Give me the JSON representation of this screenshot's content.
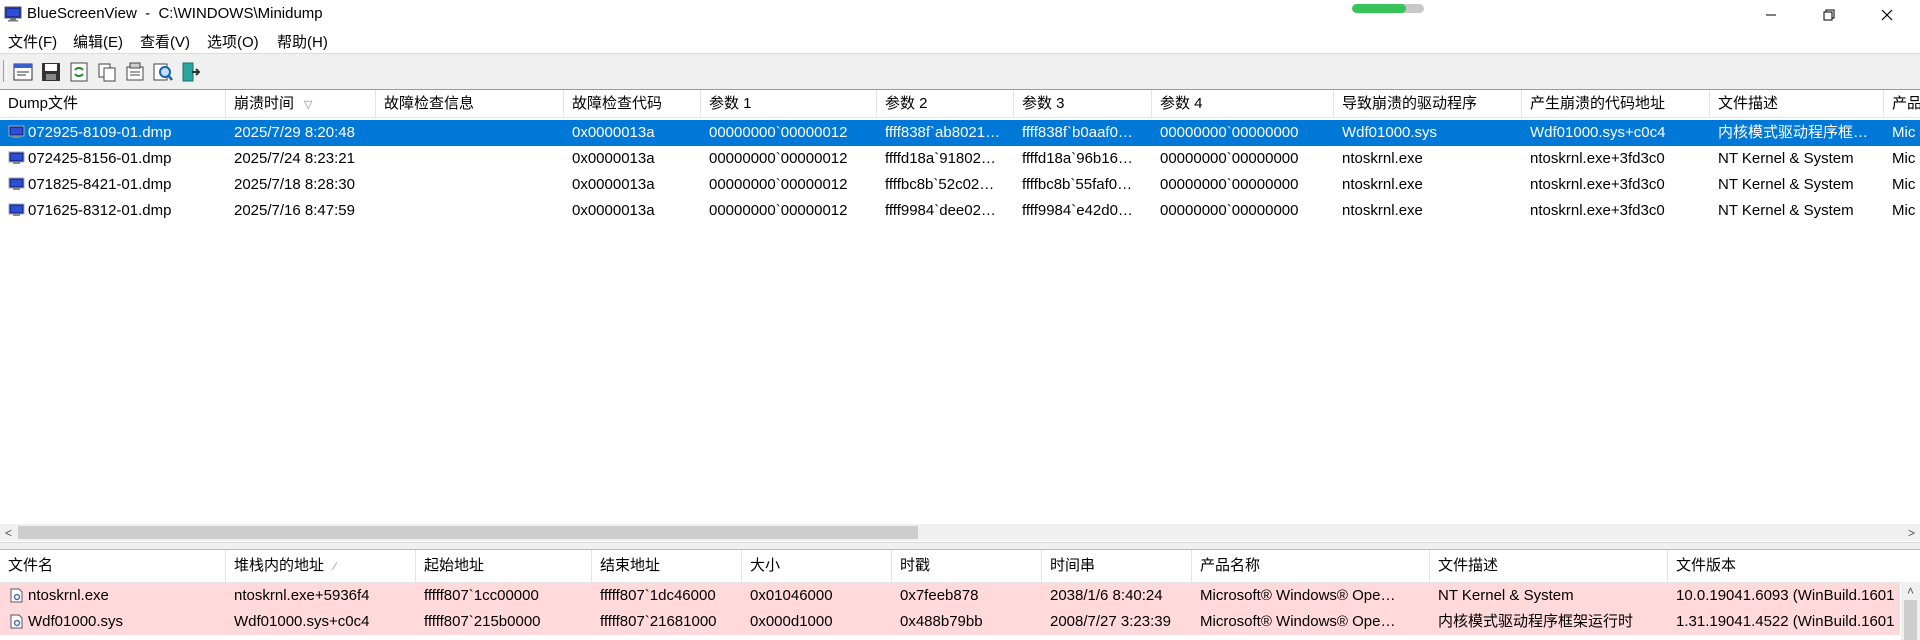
{
  "window": {
    "title": "BlueScreenView  -  C:\\WINDOWS\\Minidump",
    "progress": 0.75,
    "controls": [
      "minimize",
      "restore",
      "close"
    ]
  },
  "menu": [
    "文件(F)",
    "编辑(E)",
    "查看(V)",
    "选项(O)",
    "帮助(H)"
  ],
  "toolbar": {
    "buttons": [
      "html-report-icon",
      "save-icon",
      "refresh-icon",
      "copy-icon",
      "properties-icon",
      "find-icon",
      "exit-icon"
    ]
  },
  "colors": {
    "selection": "#0078d7",
    "lower_row_bg": "#ffd9dc",
    "progress": "#37c45a"
  },
  "upper_table": {
    "sorted_column_index": 1,
    "columns": [
      "Dump文件",
      "崩溃时间",
      "故障检查信息",
      "故障检查代码",
      "参数 1",
      "参数 2",
      "参数 3",
      "参数 4",
      "导致崩溃的驱动程序",
      "产生崩溃的代码地址",
      "文件描述",
      "产品"
    ],
    "rows": [
      [
        "072925-8109-01.dmp",
        "2025/7/29 8:20:48",
        "",
        "0x0000013a",
        "00000000`00000012",
        "ffff838f`ab8021…",
        "ffff838f`b0aaf0…",
        "00000000`00000000",
        "Wdf01000.sys",
        "Wdf01000.sys+c0c4",
        "内核模式驱动程序框…",
        "Mic"
      ],
      [
        "072425-8156-01.dmp",
        "2025/7/24 8:23:21",
        "",
        "0x0000013a",
        "00000000`00000012",
        "ffffd18a`91802…",
        "ffffd18a`96b16…",
        "00000000`00000000",
        "ntoskrnl.exe",
        "ntoskrnl.exe+3fd3c0",
        "NT Kernel & System",
        "Mic"
      ],
      [
        "071825-8421-01.dmp",
        "2025/7/18 8:28:30",
        "",
        "0x0000013a",
        "00000000`00000012",
        "ffffbc8b`52c02…",
        "ffffbc8b`55faf0…",
        "00000000`00000000",
        "ntoskrnl.exe",
        "ntoskrnl.exe+3fd3c0",
        "NT Kernel & System",
        "Mic"
      ],
      [
        "071625-8312-01.dmp",
        "2025/7/16 8:47:59",
        "",
        "0x0000013a",
        "00000000`00000012",
        "ffff9984`dee02…",
        "ffff9984`e42d0…",
        "00000000`00000000",
        "ntoskrnl.exe",
        "ntoskrnl.exe+3fd3c0",
        "NT Kernel & System",
        "Mic"
      ]
    ],
    "selected_row": 0
  },
  "lower_table": {
    "sorted_column_index": 1,
    "columns": [
      "文件名",
      "堆栈内的地址",
      "起始地址",
      "结束地址",
      "大小",
      "时戳",
      "时间串",
      "产品名称",
      "文件描述",
      "文件版本"
    ],
    "rows": [
      [
        "ntoskrnl.exe",
        "ntoskrnl.exe+5936f4",
        "fffff807`1cc00000",
        "fffff807`1dc46000",
        "0x01046000",
        "0x7feeb878",
        "2038/1/6 8:40:24",
        "Microsoft® Windows® Ope…",
        "NT Kernel & System",
        "10.0.19041.6093 (WinBuild.1601"
      ],
      [
        "Wdf01000.sys",
        "Wdf01000.sys+c0c4",
        "fffff807`215b0000",
        "fffff807`21681000",
        "0x000d1000",
        "0x488b79bb",
        "2008/7/27 3:23:39",
        "Microsoft® Windows® Ope…",
        "内核模式驱动程序框架运行时",
        "1.31.19041.4522 (WinBuild.1601"
      ]
    ]
  }
}
